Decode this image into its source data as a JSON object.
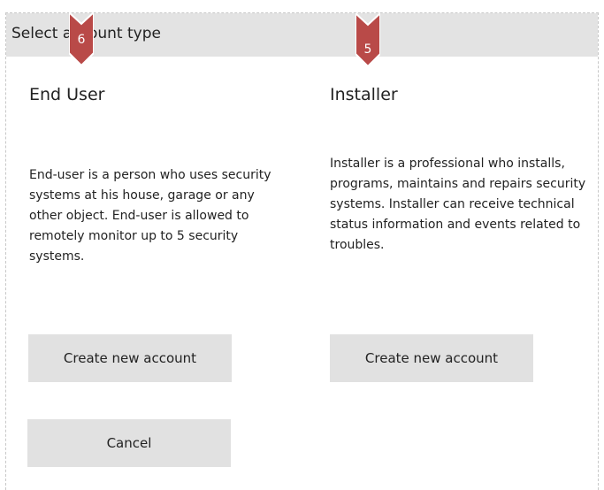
{
  "header": {
    "title": "Select account type"
  },
  "markers": [
    {
      "number": "6",
      "color": "#b94a48"
    },
    {
      "number": "5",
      "color": "#b94a48"
    }
  ],
  "end_user": {
    "title": "End User",
    "description": "End-user is a person who uses security systems at his house, garage or any other object. End-user is allowed to remotely monitor up to 5 security systems.",
    "create_button": "Create new account"
  },
  "installer": {
    "title": "Installer",
    "description": "Installer is a professional who installs, programs, maintains and repairs security systems. Installer can receive technical status information and events related to troubles.",
    "create_button": "Create new account"
  },
  "cancel_button": "Cancel"
}
